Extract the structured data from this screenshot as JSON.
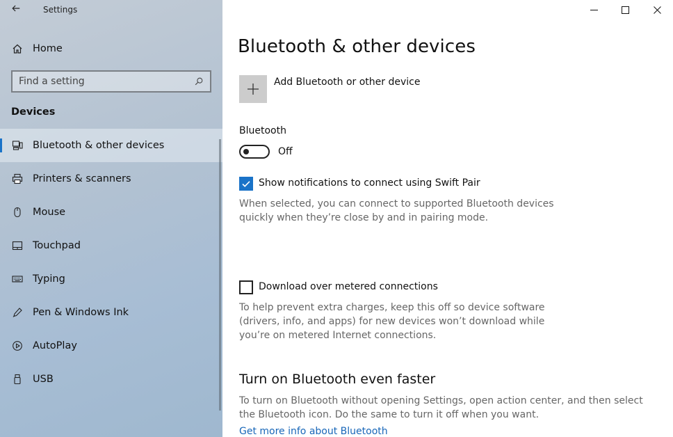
{
  "window": {
    "app_title": "Settings",
    "back_icon": "back-arrow-icon",
    "controls": {
      "minimize": "minimize-icon",
      "maximize": "maximize-icon",
      "close": "close-icon"
    }
  },
  "sidebar": {
    "home_label": "Home",
    "search_placeholder": "Find a setting",
    "section_heading": "Devices",
    "items": [
      {
        "label": "Bluetooth & other devices",
        "icon": "bluetooth-devices-icon",
        "selected": true
      },
      {
        "label": "Printers & scanners",
        "icon": "printer-icon",
        "selected": false
      },
      {
        "label": "Mouse",
        "icon": "mouse-icon",
        "selected": false
      },
      {
        "label": "Touchpad",
        "icon": "touchpad-icon",
        "selected": false
      },
      {
        "label": "Typing",
        "icon": "keyboard-icon",
        "selected": false
      },
      {
        "label": "Pen & Windows Ink",
        "icon": "pen-icon",
        "selected": false
      },
      {
        "label": "AutoPlay",
        "icon": "autoplay-icon",
        "selected": false
      },
      {
        "label": "USB",
        "icon": "usb-icon",
        "selected": false
      }
    ],
    "accent_color": "#1a73c8"
  },
  "main": {
    "title": "Bluetooth & other devices",
    "add_device_label": "Add Bluetooth or other device",
    "bluetooth": {
      "label": "Bluetooth",
      "state": "Off",
      "on": false
    },
    "swift_pair": {
      "label": "Show notifications to connect using Swift Pair",
      "checked": true,
      "description": "When selected, you can connect to supported Bluetooth devices quickly when they’re close by and in pairing mode."
    },
    "metered": {
      "label": "Download over metered connections",
      "checked": false,
      "description": "To help prevent extra charges, keep this off so device software (drivers, info, and apps) for new devices won’t download while you’re on metered Internet connections."
    },
    "faster": {
      "heading": "Turn on Bluetooth even faster",
      "description": "To turn on Bluetooth without opening Settings, open action center, and then select the Bluetooth icon. Do the same to turn it off when you want.",
      "link": "Get more info about Bluetooth"
    },
    "link_color": "#1766b8"
  }
}
